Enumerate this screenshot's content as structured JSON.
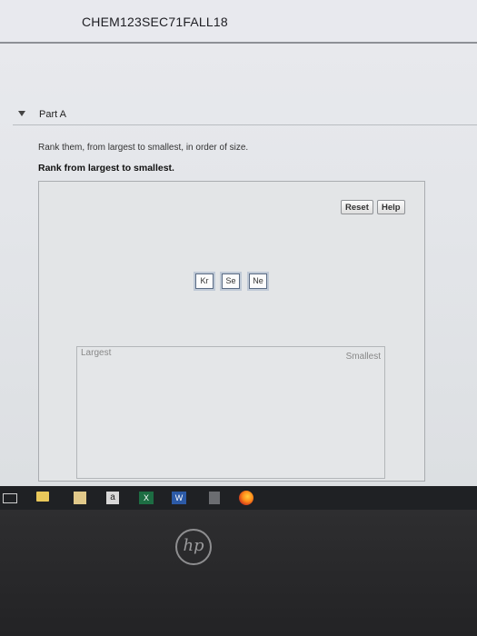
{
  "header": {
    "course_title": "CHEM123SEC71FALL18"
  },
  "part": {
    "title": "Part A"
  },
  "question": {
    "instruction": "Rank them, from largest to smallest, in order of size.",
    "bold_instruction": "Rank from largest to smallest."
  },
  "panel": {
    "reset_label": "Reset",
    "help_label": "Help",
    "chips": [
      "Kr",
      "Se",
      "Ne"
    ],
    "largest_label": "Largest",
    "smallest_label": "Smallest"
  },
  "taskbar": {
    "amazon_glyph": "a",
    "excel_glyph": "X",
    "word_glyph": "W"
  },
  "device": {
    "logo_text": "hp"
  }
}
